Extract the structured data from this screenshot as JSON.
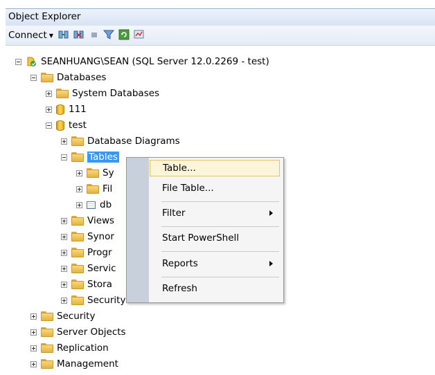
{
  "panel": {
    "title": "Object Explorer"
  },
  "toolbar": {
    "connect_label": "Connect"
  },
  "tree": {
    "server": "SEANHUANG\\SEAN (SQL Server 12.0.2269 - test)",
    "databases": "Databases",
    "system_databases": "System Databases",
    "db_111": "111",
    "db_test": "test",
    "database_diagrams": "Database Diagrams",
    "tables": "Tables",
    "tables_children": [
      "Sy",
      "Fil",
      "db"
    ],
    "test_children": [
      "Views",
      "Synor",
      "Progr",
      "Servic",
      "Stora",
      "Security"
    ],
    "server_children": [
      "Security",
      "Server Objects",
      "Replication",
      "Management"
    ]
  },
  "context_menu": {
    "items": [
      "Table...",
      "File Table...",
      "Filter",
      "Start PowerShell",
      "Reports",
      "Refresh"
    ]
  }
}
